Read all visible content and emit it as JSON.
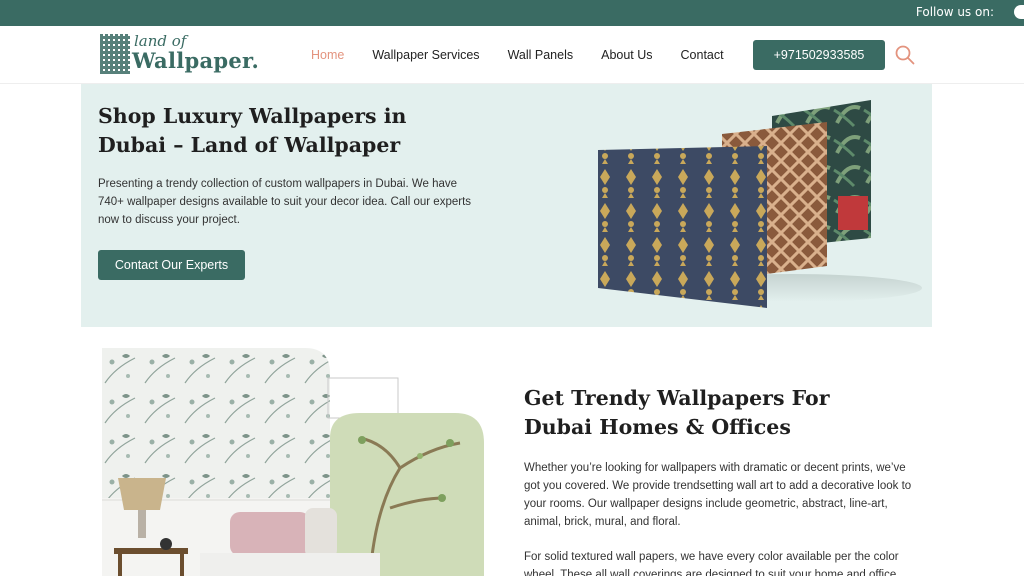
{
  "topbar": {
    "follow_text": "Follow us on:"
  },
  "header": {
    "logo_top": "land of",
    "logo_main": "Wallpaper.",
    "nav": [
      "Home",
      "Wallpaper Services",
      "Wall Panels",
      "About Us",
      "Contact"
    ],
    "active_nav": "Home",
    "phone": "+971502933585"
  },
  "hero": {
    "title": "Shop Luxury Wallpapers in Dubai – Land of Wallpaper",
    "text": "Presenting a trendy collection of custom wallpapers in Dubai. We have 740+ wallpaper designs available to suit your decor idea. Call our experts now to discuss your project.",
    "button": "Contact Our Experts"
  },
  "section2": {
    "title": "Get Trendy Wallpapers For Dubai Homes & Offices",
    "p1": "Whether you’re looking for wallpapers with dramatic or decent prints, we’ve got you covered. We provide trendsetting wall art to add a decorative look to your rooms. Our wallpaper designs include geometric, abstract, line-art, animal, brick, mural, and floral.",
    "p2": "For solid textured wall papers, we have every color available per the color wheel. These all wall coverings are designed to suit your home and office decor."
  },
  "colors": {
    "brand": "#3a6b63",
    "accent": "#e3937e",
    "hero_bg": "#e3f0ee"
  },
  "icons": [
    "facebook-icon",
    "search-icon",
    "logo-grid-icon"
  ]
}
